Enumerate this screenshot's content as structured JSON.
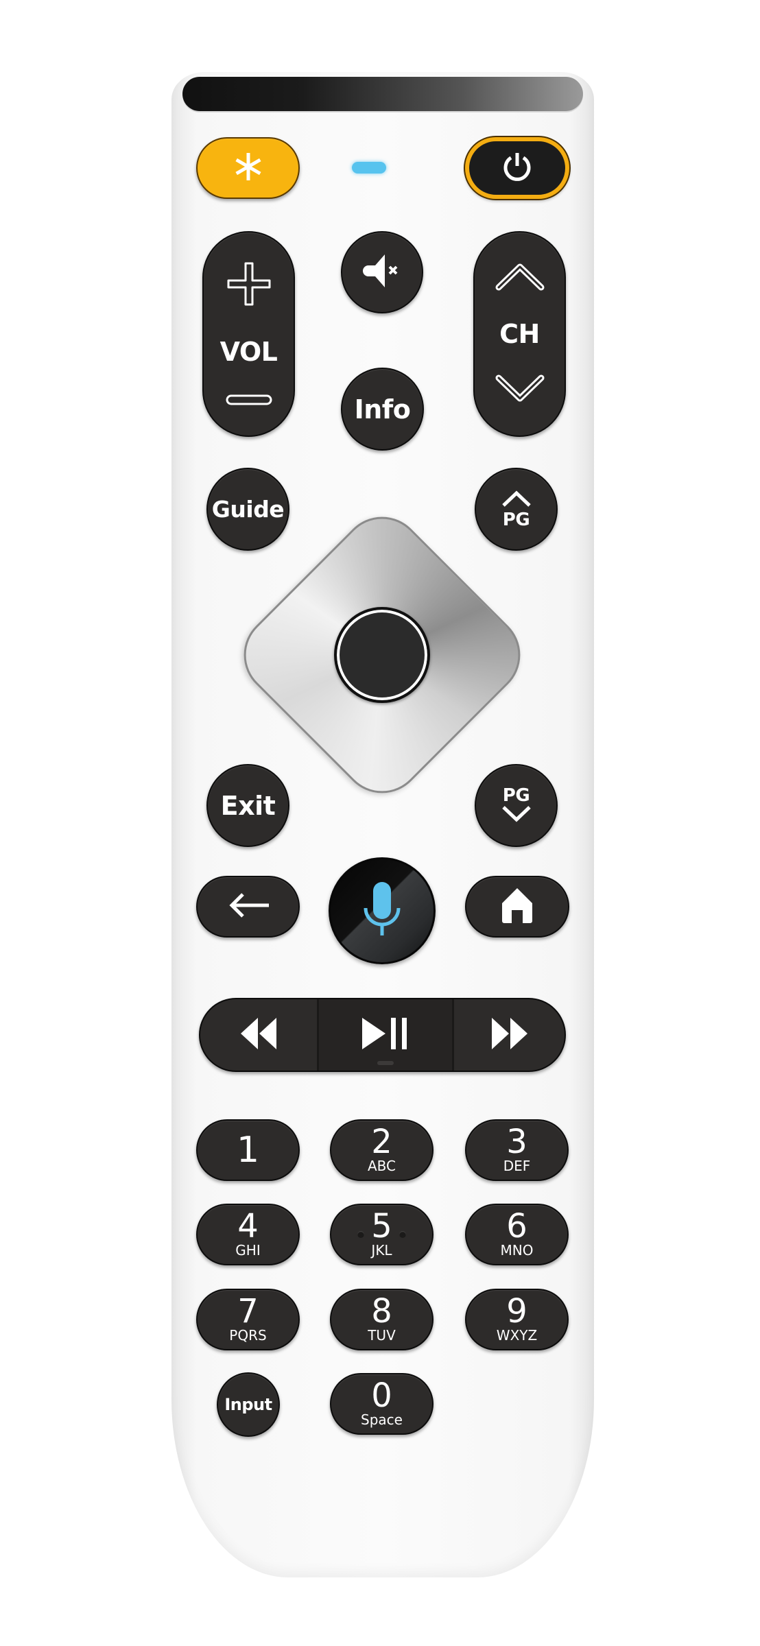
{
  "device": {
    "name": "TV remote control",
    "led_color": "#57c3ee",
    "accent_color": "#f8b40f",
    "button_color": "#2d2b2a"
  },
  "top_row": {
    "star": {
      "icon": "asterisk-icon",
      "glyph": "✱"
    },
    "power": {
      "icon": "power-icon"
    }
  },
  "volume": {
    "label": "VOL",
    "up_icon": "plus-icon",
    "down_icon": "minus-icon"
  },
  "mute": {
    "icon": "mute-icon"
  },
  "channel": {
    "label": "CH",
    "up_icon": "chevron-up-icon",
    "down_icon": "chevron-down-icon"
  },
  "info": {
    "label": "Info"
  },
  "guide": {
    "label": "Guide"
  },
  "page_up": {
    "label": "PG"
  },
  "page_down": {
    "label": "PG"
  },
  "exit": {
    "label": "Exit"
  },
  "back": {
    "icon": "arrow-left-icon"
  },
  "voice": {
    "icon": "microphone-icon"
  },
  "home": {
    "icon": "home-icon"
  },
  "media": {
    "rewind": "rewind-icon",
    "play_pause": "play-pause-icon",
    "fast_forward": "fast-forward-icon"
  },
  "keypad": [
    {
      "digit": "1",
      "letters": ""
    },
    {
      "digit": "2",
      "letters": "ABC"
    },
    {
      "digit": "3",
      "letters": "DEF"
    },
    {
      "digit": "4",
      "letters": "GHI"
    },
    {
      "digit": "5",
      "letters": "JKL"
    },
    {
      "digit": "6",
      "letters": "MNO"
    },
    {
      "digit": "7",
      "letters": "PQRS"
    },
    {
      "digit": "8",
      "letters": "TUV"
    },
    {
      "digit": "9",
      "letters": "WXYZ"
    },
    {
      "digit": "0",
      "letters": "Space"
    }
  ],
  "input": {
    "label": "Input"
  }
}
